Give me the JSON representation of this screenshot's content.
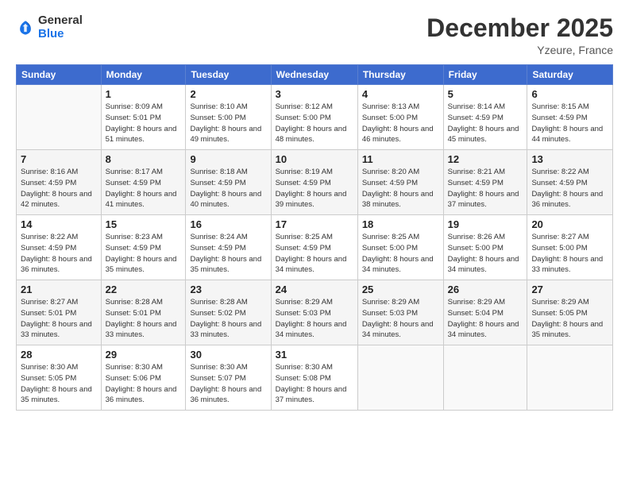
{
  "header": {
    "logo_general": "General",
    "logo_blue": "Blue",
    "month_title": "December 2025",
    "location": "Yzeure, France"
  },
  "days_of_week": [
    "Sunday",
    "Monday",
    "Tuesday",
    "Wednesday",
    "Thursday",
    "Friday",
    "Saturday"
  ],
  "weeks": [
    [
      {
        "day": "",
        "empty": true
      },
      {
        "day": "1",
        "sunrise": "8:09 AM",
        "sunset": "5:01 PM",
        "daylight": "8 hours and 51 minutes."
      },
      {
        "day": "2",
        "sunrise": "8:10 AM",
        "sunset": "5:00 PM",
        "daylight": "8 hours and 49 minutes."
      },
      {
        "day": "3",
        "sunrise": "8:12 AM",
        "sunset": "5:00 PM",
        "daylight": "8 hours and 48 minutes."
      },
      {
        "day": "4",
        "sunrise": "8:13 AM",
        "sunset": "5:00 PM",
        "daylight": "8 hours and 46 minutes."
      },
      {
        "day": "5",
        "sunrise": "8:14 AM",
        "sunset": "4:59 PM",
        "daylight": "8 hours and 45 minutes."
      },
      {
        "day": "6",
        "sunrise": "8:15 AM",
        "sunset": "4:59 PM",
        "daylight": "8 hours and 44 minutes."
      }
    ],
    [
      {
        "day": "7",
        "sunrise": "8:16 AM",
        "sunset": "4:59 PM",
        "daylight": "8 hours and 42 minutes."
      },
      {
        "day": "8",
        "sunrise": "8:17 AM",
        "sunset": "4:59 PM",
        "daylight": "8 hours and 41 minutes."
      },
      {
        "day": "9",
        "sunrise": "8:18 AM",
        "sunset": "4:59 PM",
        "daylight": "8 hours and 40 minutes."
      },
      {
        "day": "10",
        "sunrise": "8:19 AM",
        "sunset": "4:59 PM",
        "daylight": "8 hours and 39 minutes."
      },
      {
        "day": "11",
        "sunrise": "8:20 AM",
        "sunset": "4:59 PM",
        "daylight": "8 hours and 38 minutes."
      },
      {
        "day": "12",
        "sunrise": "8:21 AM",
        "sunset": "4:59 PM",
        "daylight": "8 hours and 37 minutes."
      },
      {
        "day": "13",
        "sunrise": "8:22 AM",
        "sunset": "4:59 PM",
        "daylight": "8 hours and 36 minutes."
      }
    ],
    [
      {
        "day": "14",
        "sunrise": "8:22 AM",
        "sunset": "4:59 PM",
        "daylight": "8 hours and 36 minutes."
      },
      {
        "day": "15",
        "sunrise": "8:23 AM",
        "sunset": "4:59 PM",
        "daylight": "8 hours and 35 minutes."
      },
      {
        "day": "16",
        "sunrise": "8:24 AM",
        "sunset": "4:59 PM",
        "daylight": "8 hours and 35 minutes."
      },
      {
        "day": "17",
        "sunrise": "8:25 AM",
        "sunset": "4:59 PM",
        "daylight": "8 hours and 34 minutes."
      },
      {
        "day": "18",
        "sunrise": "8:25 AM",
        "sunset": "5:00 PM",
        "daylight": "8 hours and 34 minutes."
      },
      {
        "day": "19",
        "sunrise": "8:26 AM",
        "sunset": "5:00 PM",
        "daylight": "8 hours and 34 minutes."
      },
      {
        "day": "20",
        "sunrise": "8:27 AM",
        "sunset": "5:00 PM",
        "daylight": "8 hours and 33 minutes."
      }
    ],
    [
      {
        "day": "21",
        "sunrise": "8:27 AM",
        "sunset": "5:01 PM",
        "daylight": "8 hours and 33 minutes."
      },
      {
        "day": "22",
        "sunrise": "8:28 AM",
        "sunset": "5:01 PM",
        "daylight": "8 hours and 33 minutes."
      },
      {
        "day": "23",
        "sunrise": "8:28 AM",
        "sunset": "5:02 PM",
        "daylight": "8 hours and 33 minutes."
      },
      {
        "day": "24",
        "sunrise": "8:29 AM",
        "sunset": "5:03 PM",
        "daylight": "8 hours and 34 minutes."
      },
      {
        "day": "25",
        "sunrise": "8:29 AM",
        "sunset": "5:03 PM",
        "daylight": "8 hours and 34 minutes."
      },
      {
        "day": "26",
        "sunrise": "8:29 AM",
        "sunset": "5:04 PM",
        "daylight": "8 hours and 34 minutes."
      },
      {
        "day": "27",
        "sunrise": "8:29 AM",
        "sunset": "5:05 PM",
        "daylight": "8 hours and 35 minutes."
      }
    ],
    [
      {
        "day": "28",
        "sunrise": "8:30 AM",
        "sunset": "5:05 PM",
        "daylight": "8 hours and 35 minutes."
      },
      {
        "day": "29",
        "sunrise": "8:30 AM",
        "sunset": "5:06 PM",
        "daylight": "8 hours and 36 minutes."
      },
      {
        "day": "30",
        "sunrise": "8:30 AM",
        "sunset": "5:07 PM",
        "daylight": "8 hours and 36 minutes."
      },
      {
        "day": "31",
        "sunrise": "8:30 AM",
        "sunset": "5:08 PM",
        "daylight": "8 hours and 37 minutes."
      },
      {
        "day": "",
        "empty": true
      },
      {
        "day": "",
        "empty": true
      },
      {
        "day": "",
        "empty": true
      }
    ]
  ],
  "labels": {
    "sunrise_prefix": "Sunrise: ",
    "sunset_prefix": "Sunset: ",
    "daylight_prefix": "Daylight: "
  }
}
